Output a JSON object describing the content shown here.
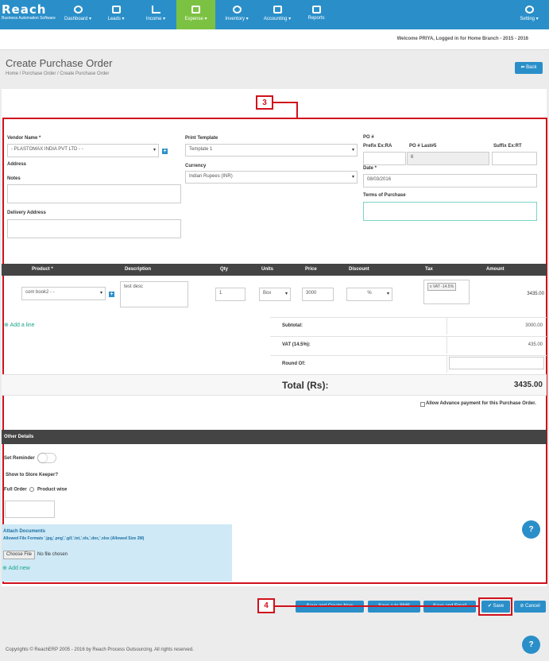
{
  "brand": {
    "name": "Reach",
    "tagline": "Business Automation Software"
  },
  "nav": {
    "dashboard": "Dashboard ▾",
    "leads": "Leads ▾",
    "income": "Income ▾",
    "expense": "Expense ▾",
    "inventory": "Inventory ▾",
    "accounting": "Accounting ▾",
    "reports": "Reports",
    "setting": "Setting ▾"
  },
  "welcome": "Welcome PRIYA, Logged in for Home Branch - 2015 - 2016",
  "page": {
    "title": "Create Purchase Order",
    "breadcrumb": "Home  /  Purchase Order  /  Create Purchase Order",
    "back": "⬅ Back"
  },
  "annotations": {
    "three": "3",
    "four": "4"
  },
  "form": {
    "vendor_label": "Vendor Name *",
    "vendor_value": "- PLASTOMAX INDIA PVT LTD - -",
    "address_label": "Address",
    "notes_label": "Notes",
    "delivery_label": "Delivery Address",
    "print_template_label": "Print Template",
    "print_template_value": "Template 1",
    "currency_label": "Currency",
    "currency_value": "Indian Rupees (INR)",
    "po_label": "PO #",
    "prefix_label": "Prefix Ex:RA",
    "po_last_label": "PO # Last#5",
    "suffix_label": "Suffix Ex:RT",
    "po_last_value": "6",
    "date_label": "Date *",
    "date_value": "08/03/2016",
    "terms_label": "Terms of Purchase"
  },
  "table": {
    "headers": [
      "Product *",
      "Description",
      "Qty",
      "Units",
      "Price",
      "Discount",
      "Tax",
      "Amount"
    ],
    "row": {
      "product": "com book2 - -",
      "description": "test desc",
      "qty": "1",
      "unit": "Box",
      "price": "3000",
      "discount": "%",
      "tax": "x VAT -14.5%",
      "amount": "3435.00"
    },
    "add_line": "Add a line"
  },
  "totals": {
    "subtotal_label": "Subtotal:",
    "subtotal_value": "3000.00",
    "vat_label": "VAT (14.5%):",
    "vat_value": "435.00",
    "roundof_label": "Round Of:",
    "total_label": "Total (Rs):",
    "total_value": "3435.00",
    "advance_label": "Allow Advance payment for this Purchase Order."
  },
  "other": {
    "header": "Other Details",
    "reminder": "Set Reminder",
    "show_store": "Show to Store Keeper?",
    "full_order": "Full Order",
    "product_wise": "Product wise",
    "attach_title": "Attach Documents",
    "attach_formats": "Allowed File Formats '.jpg,'.png','.gif,'.txt,'.xls,'.doc,'.xlsx (Allowed Size 2M)",
    "choose_file": "Choose File",
    "no_file": "No file chosen",
    "add_new": "Add new"
  },
  "buttons": {
    "save_create_new": "Save and Create New",
    "save_sms": "Save a to SMS",
    "save_email": "Save and Email",
    "save": "✔ Save",
    "cancel": "⊘ Cancel"
  },
  "footer": "Copyrights © ReachERP 2005 - 2016 by Reach Process Outsourcing. All rights reserved.",
  "colors": {
    "primary": "#2a8fc9",
    "active": "#7cc242",
    "annotation": "#d0111b",
    "dark_header": "#444444"
  }
}
